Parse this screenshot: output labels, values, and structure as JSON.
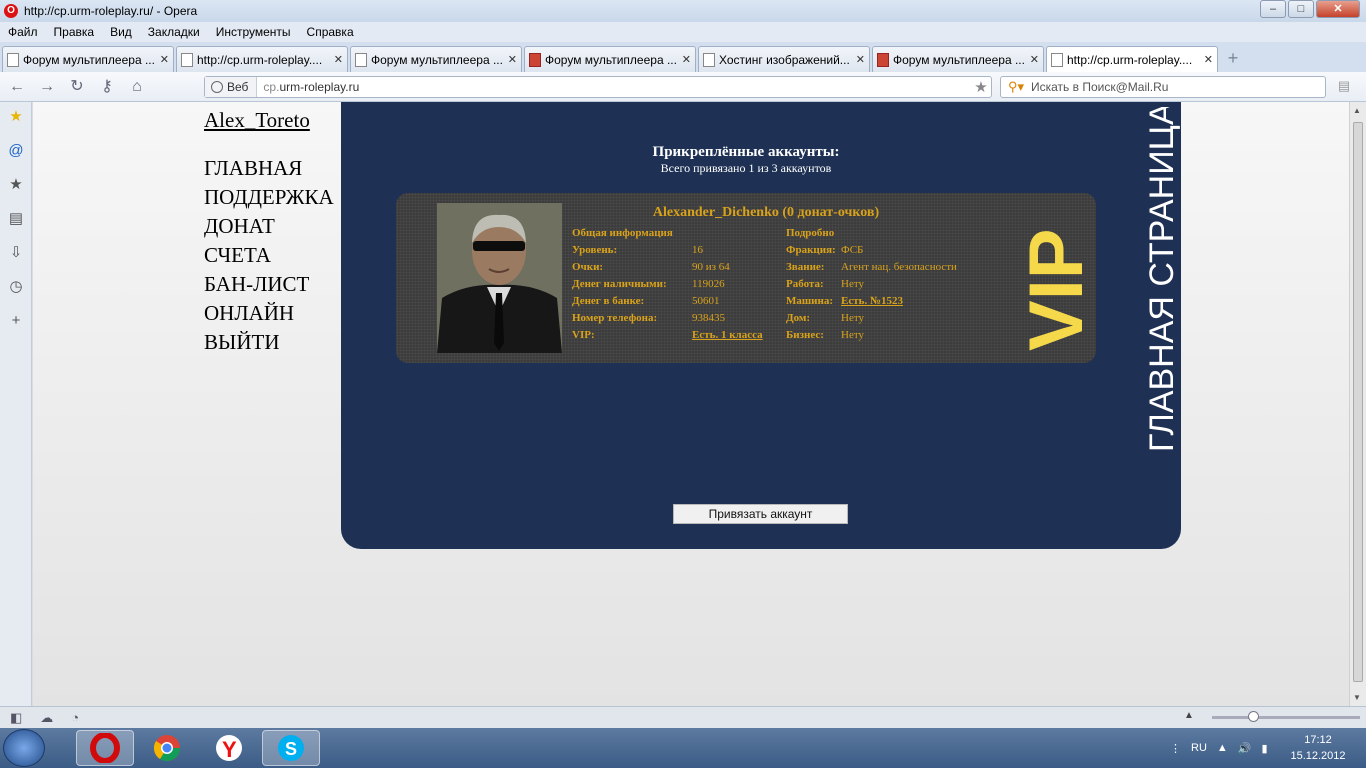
{
  "window": {
    "title": "http://cp.urm-roleplay.ru/ - Opera",
    "controls": {
      "minimize": "–",
      "maximize": "□",
      "close": "✕"
    }
  },
  "menu": [
    "Файл",
    "Правка",
    "Вид",
    "Закладки",
    "Инструменты",
    "Справка"
  ],
  "tabs": [
    {
      "label": "Форум мультиплеера ...",
      "favicon": "page",
      "active": false
    },
    {
      "label": "http://cp.urm-roleplay....",
      "favicon": "page",
      "active": false
    },
    {
      "label": "Форум мультиплеера ...",
      "favicon": "page",
      "active": false
    },
    {
      "label": "Форум мультиплеера ...",
      "favicon": "red",
      "active": false
    },
    {
      "label": "Хостинг изображений...",
      "favicon": "page",
      "active": false
    },
    {
      "label": "Форум мультиплеера ...",
      "favicon": "red",
      "active": false
    },
    {
      "label": "http://cp.urm-roleplay....",
      "favicon": "page",
      "active": true
    }
  ],
  "address": {
    "scheme_label": "Веб",
    "url_prefix": "cp.",
    "url_domain": "urm-roleplay.ru",
    "search_placeholder": "Искать в Поиск@Mail.Ru"
  },
  "site": {
    "username": "Alex_Toreto",
    "nav": [
      "ГЛАВНАЯ",
      "ПОДДЕРЖКА",
      "ДОНАТ",
      "СЧЕТА",
      "БАН-ЛИСТ",
      "ОНЛАЙН",
      "ВЫЙТИ"
    ],
    "vertical_title": "ГЛАВНАЯ СТРАНИЦА",
    "panel_title": "Прикреплённые аккаунты:",
    "panel_subtitle": "Всего привязано 1 из 3 аккаунтов",
    "bind_button": "Привязать аккаунт",
    "account": {
      "name": "Alexander_Dichenko (0 донат-очков)",
      "general_header": "Общая информация",
      "detail_header": "Подробно",
      "left": [
        {
          "label": "Уровень:",
          "value": "16",
          "link": false
        },
        {
          "label": "Очки:",
          "value": "90 из 64",
          "link": false
        },
        {
          "label": "Денег наличными:",
          "value": "119026",
          "link": false
        },
        {
          "label": "Денег в банке:",
          "value": "50601",
          "link": false
        },
        {
          "label": "Номер телефона:",
          "value": "938435",
          "link": false
        },
        {
          "label": "VIP:",
          "value": "Есть. 1 класса",
          "link": true
        }
      ],
      "right": [
        {
          "label": "Фракция:",
          "value": "ФСБ",
          "link": false
        },
        {
          "label": "Звание:",
          "value": "Агент нац. безопасности",
          "link": false
        },
        {
          "label": "Работа:",
          "value": "Нету",
          "link": false
        },
        {
          "label": "Машина:",
          "value": "Есть. №1523",
          "link": true
        },
        {
          "label": "Дом:",
          "value": "Нету",
          "link": false
        },
        {
          "label": "Бизнес:",
          "value": "Нету",
          "link": false
        }
      ],
      "vip_badge": "VIP"
    }
  },
  "taskbar": {
    "lang": "RU",
    "time": "17:12",
    "date": "15.12.2012"
  },
  "colors": {
    "panel_bg": "#1e3154",
    "gold_text": "#d9a21b",
    "vip_yellow": "#f6d94a"
  }
}
